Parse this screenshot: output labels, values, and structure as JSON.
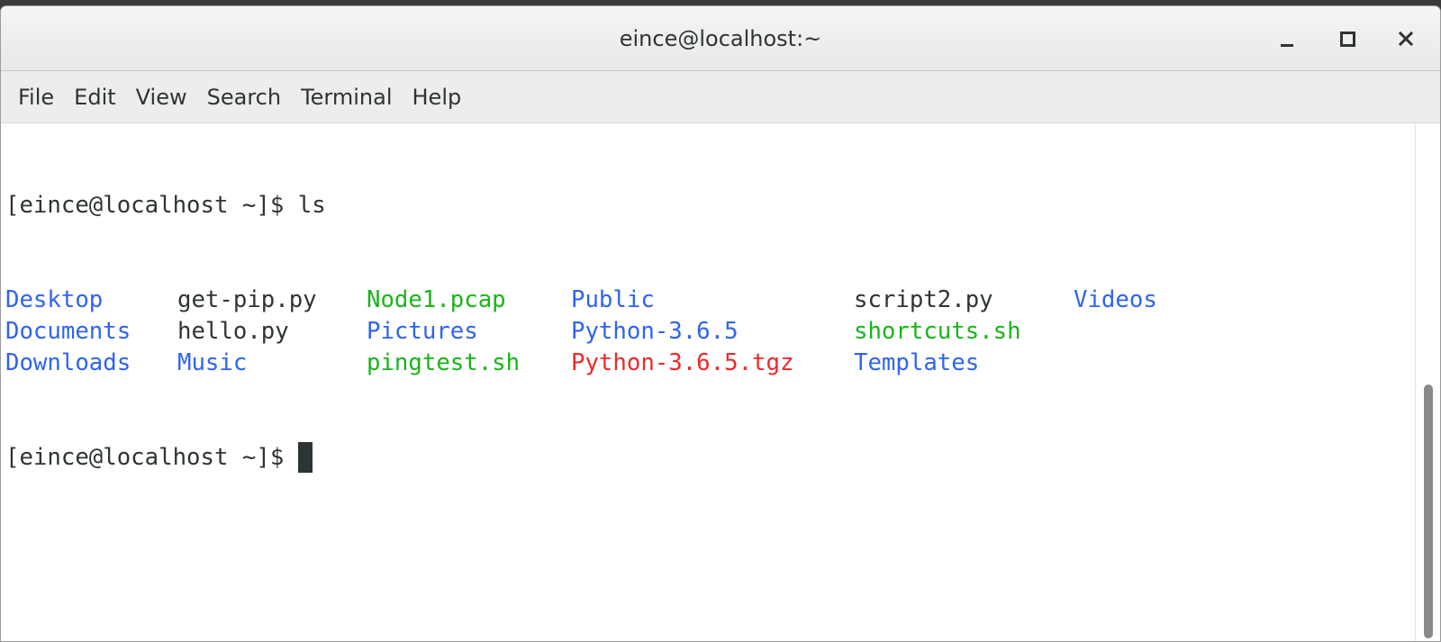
{
  "window": {
    "title": "eince@localhost:~"
  },
  "menubar": {
    "items": [
      "File",
      "Edit",
      "View",
      "Search",
      "Terminal",
      "Help"
    ]
  },
  "terminal": {
    "prompt": "[eince@localhost ~]$ ",
    "command": "ls",
    "listing": [
      [
        {
          "name": "Desktop",
          "type": "dir"
        },
        {
          "name": "get-pip.py",
          "type": "file"
        },
        {
          "name": "Node1.pcap",
          "type": "exec"
        },
        {
          "name": "Public",
          "type": "dir"
        },
        {
          "name": "script2.py",
          "type": "file"
        },
        {
          "name": "Videos",
          "type": "dir"
        }
      ],
      [
        {
          "name": "Documents",
          "type": "dir"
        },
        {
          "name": "hello.py",
          "type": "file"
        },
        {
          "name": "Pictures",
          "type": "dir"
        },
        {
          "name": "Python-3.6.5",
          "type": "dir"
        },
        {
          "name": "shortcuts.sh",
          "type": "exec"
        }
      ],
      [
        {
          "name": "Downloads",
          "type": "dir"
        },
        {
          "name": "Music",
          "type": "dir"
        },
        {
          "name": "pingtest.sh",
          "type": "exec"
        },
        {
          "name": "Python-3.6.5.tgz",
          "type": "archive"
        },
        {
          "name": "Templates",
          "type": "dir"
        }
      ]
    ]
  },
  "colors": {
    "dir": "#2f64f0",
    "exec": "#1ab41a",
    "archive": "#ef2929",
    "file": "#2e3436"
  },
  "icons": {
    "minimize": "minimize-icon",
    "maximize": "maximize-icon",
    "close": "close-icon"
  }
}
